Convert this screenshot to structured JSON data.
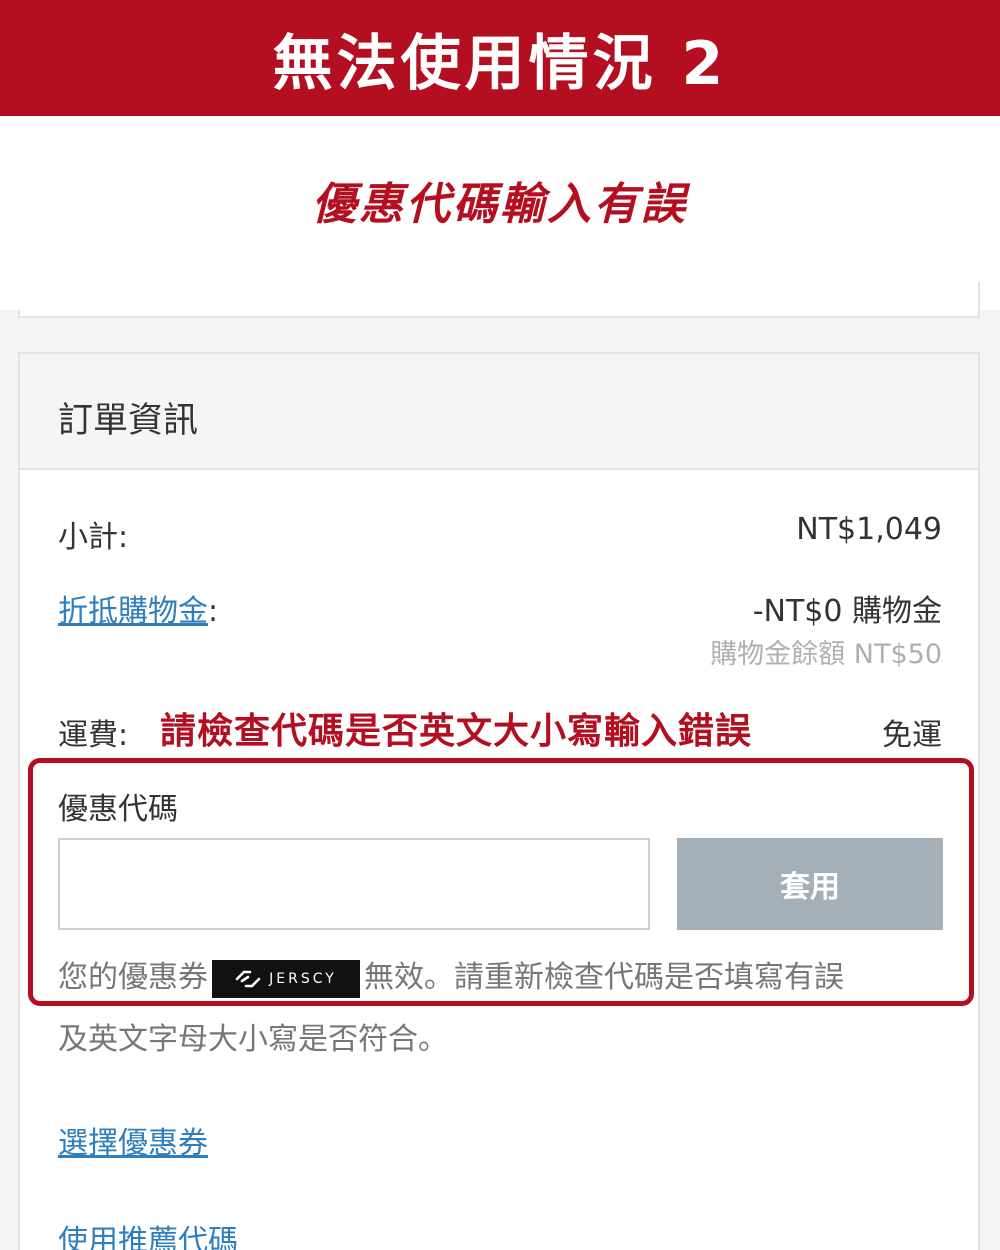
{
  "banner": {
    "title": "無法使用情況 2"
  },
  "subtitle": "優惠代碼輸入有誤",
  "order": {
    "title": "訂單資訊",
    "subtotal_label": "小計:",
    "subtotal_value": "NT$1,049",
    "credit_link": "折抵購物金",
    "credit_colon": ":",
    "credit_value": "-NT$0 購物金",
    "credit_balance": "購物金餘額 NT$50",
    "shipping_label": "運費:",
    "shipping_value": "免運"
  },
  "annotation": {
    "warning": "請檢查代碼是否英文大小寫輸入錯誤"
  },
  "coupon": {
    "label": "優惠代碼",
    "input_value": "",
    "apply_label": "套用",
    "error_prefix": "您的優惠券",
    "code_text": "JERSCY",
    "error_suffix": "無效。請重新檢查代碼是否填寫有誤",
    "error_line2": "及英文字母大小寫是否符合。"
  },
  "links": {
    "choose_coupon": "選擇優惠券",
    "referral_code": "使用推薦代碼"
  },
  "colors": {
    "brand_red": "#b40f20",
    "link_blue": "#2f7fbf",
    "button_gray": "#a5afb7"
  }
}
